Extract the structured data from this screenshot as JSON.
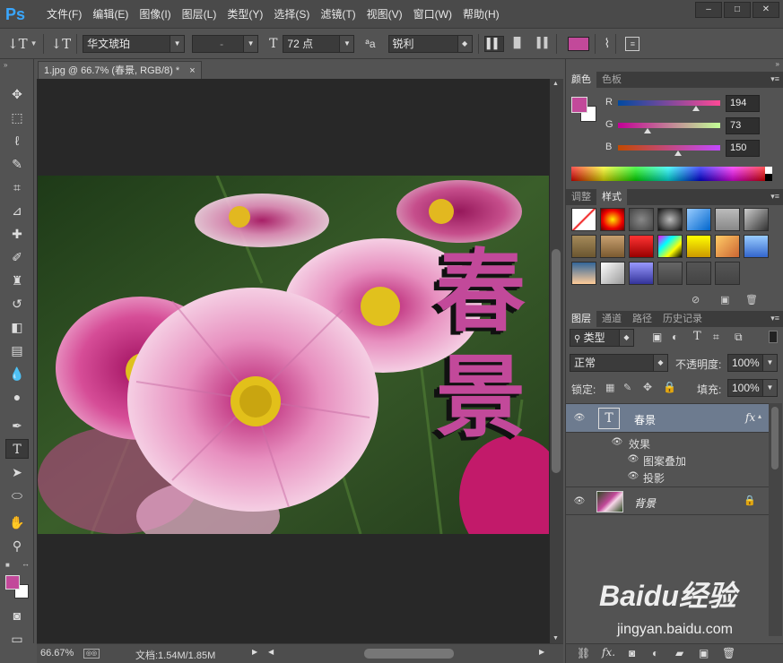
{
  "app": {
    "logo": "Ps",
    "menu": [
      "文件(F)",
      "编辑(E)",
      "图像(I)",
      "图层(L)",
      "类型(Y)",
      "选择(S)",
      "滤镜(T)",
      "视图(V)",
      "窗口(W)",
      "帮助(H)"
    ],
    "window_controls": [
      "–",
      "□",
      "✕"
    ]
  },
  "options": {
    "tool_glyph": "↓T",
    "orient_glyph": "↓T",
    "font_family": "华文琥珀",
    "font_style": "-",
    "size_glyph": "T",
    "font_size": "72 点",
    "aa_glyph": "ªa",
    "antialias": "锐利",
    "text_color": "#c2499a"
  },
  "document": {
    "tab_title": "1.jpg @ 66.7% (春景, RGB/8) *",
    "tab_close": "×",
    "overlay_text_line1": "春",
    "overlay_text_line2": "景"
  },
  "status": {
    "zoom": "66.67%",
    "doc_size": "文档:1.54M/1.85M"
  },
  "color_panel": {
    "tabs": [
      "颜色",
      "色板"
    ],
    "foreground": "#c2499a",
    "channels": [
      {
        "label": "R",
        "value": "194",
        "fraction": 0.76
      },
      {
        "label": "G",
        "value": "73",
        "fraction": 0.29
      },
      {
        "label": "B",
        "value": "150",
        "fraction": 0.59
      }
    ]
  },
  "styles_panel": {
    "tabs": [
      "调整",
      "样式"
    ]
  },
  "layers_panel": {
    "tabs": [
      "图层",
      "通道",
      "路径",
      "历史记录"
    ],
    "filter_kind": "类型",
    "blend_mode": "正常",
    "opacity_label": "不透明度:",
    "opacity_value": "100%",
    "lock_label": "锁定:",
    "fill_label": "填充:",
    "fill_value": "100%",
    "layers": [
      {
        "name": "春景",
        "type": "text",
        "fx": "fx",
        "effects_label": "效果",
        "effects": [
          "图案叠加",
          "投影"
        ]
      },
      {
        "name": "背景",
        "type": "image",
        "locked": true
      }
    ]
  },
  "watermark": {
    "brand": "Baidu经验",
    "url": "jingyan.baidu.com"
  }
}
